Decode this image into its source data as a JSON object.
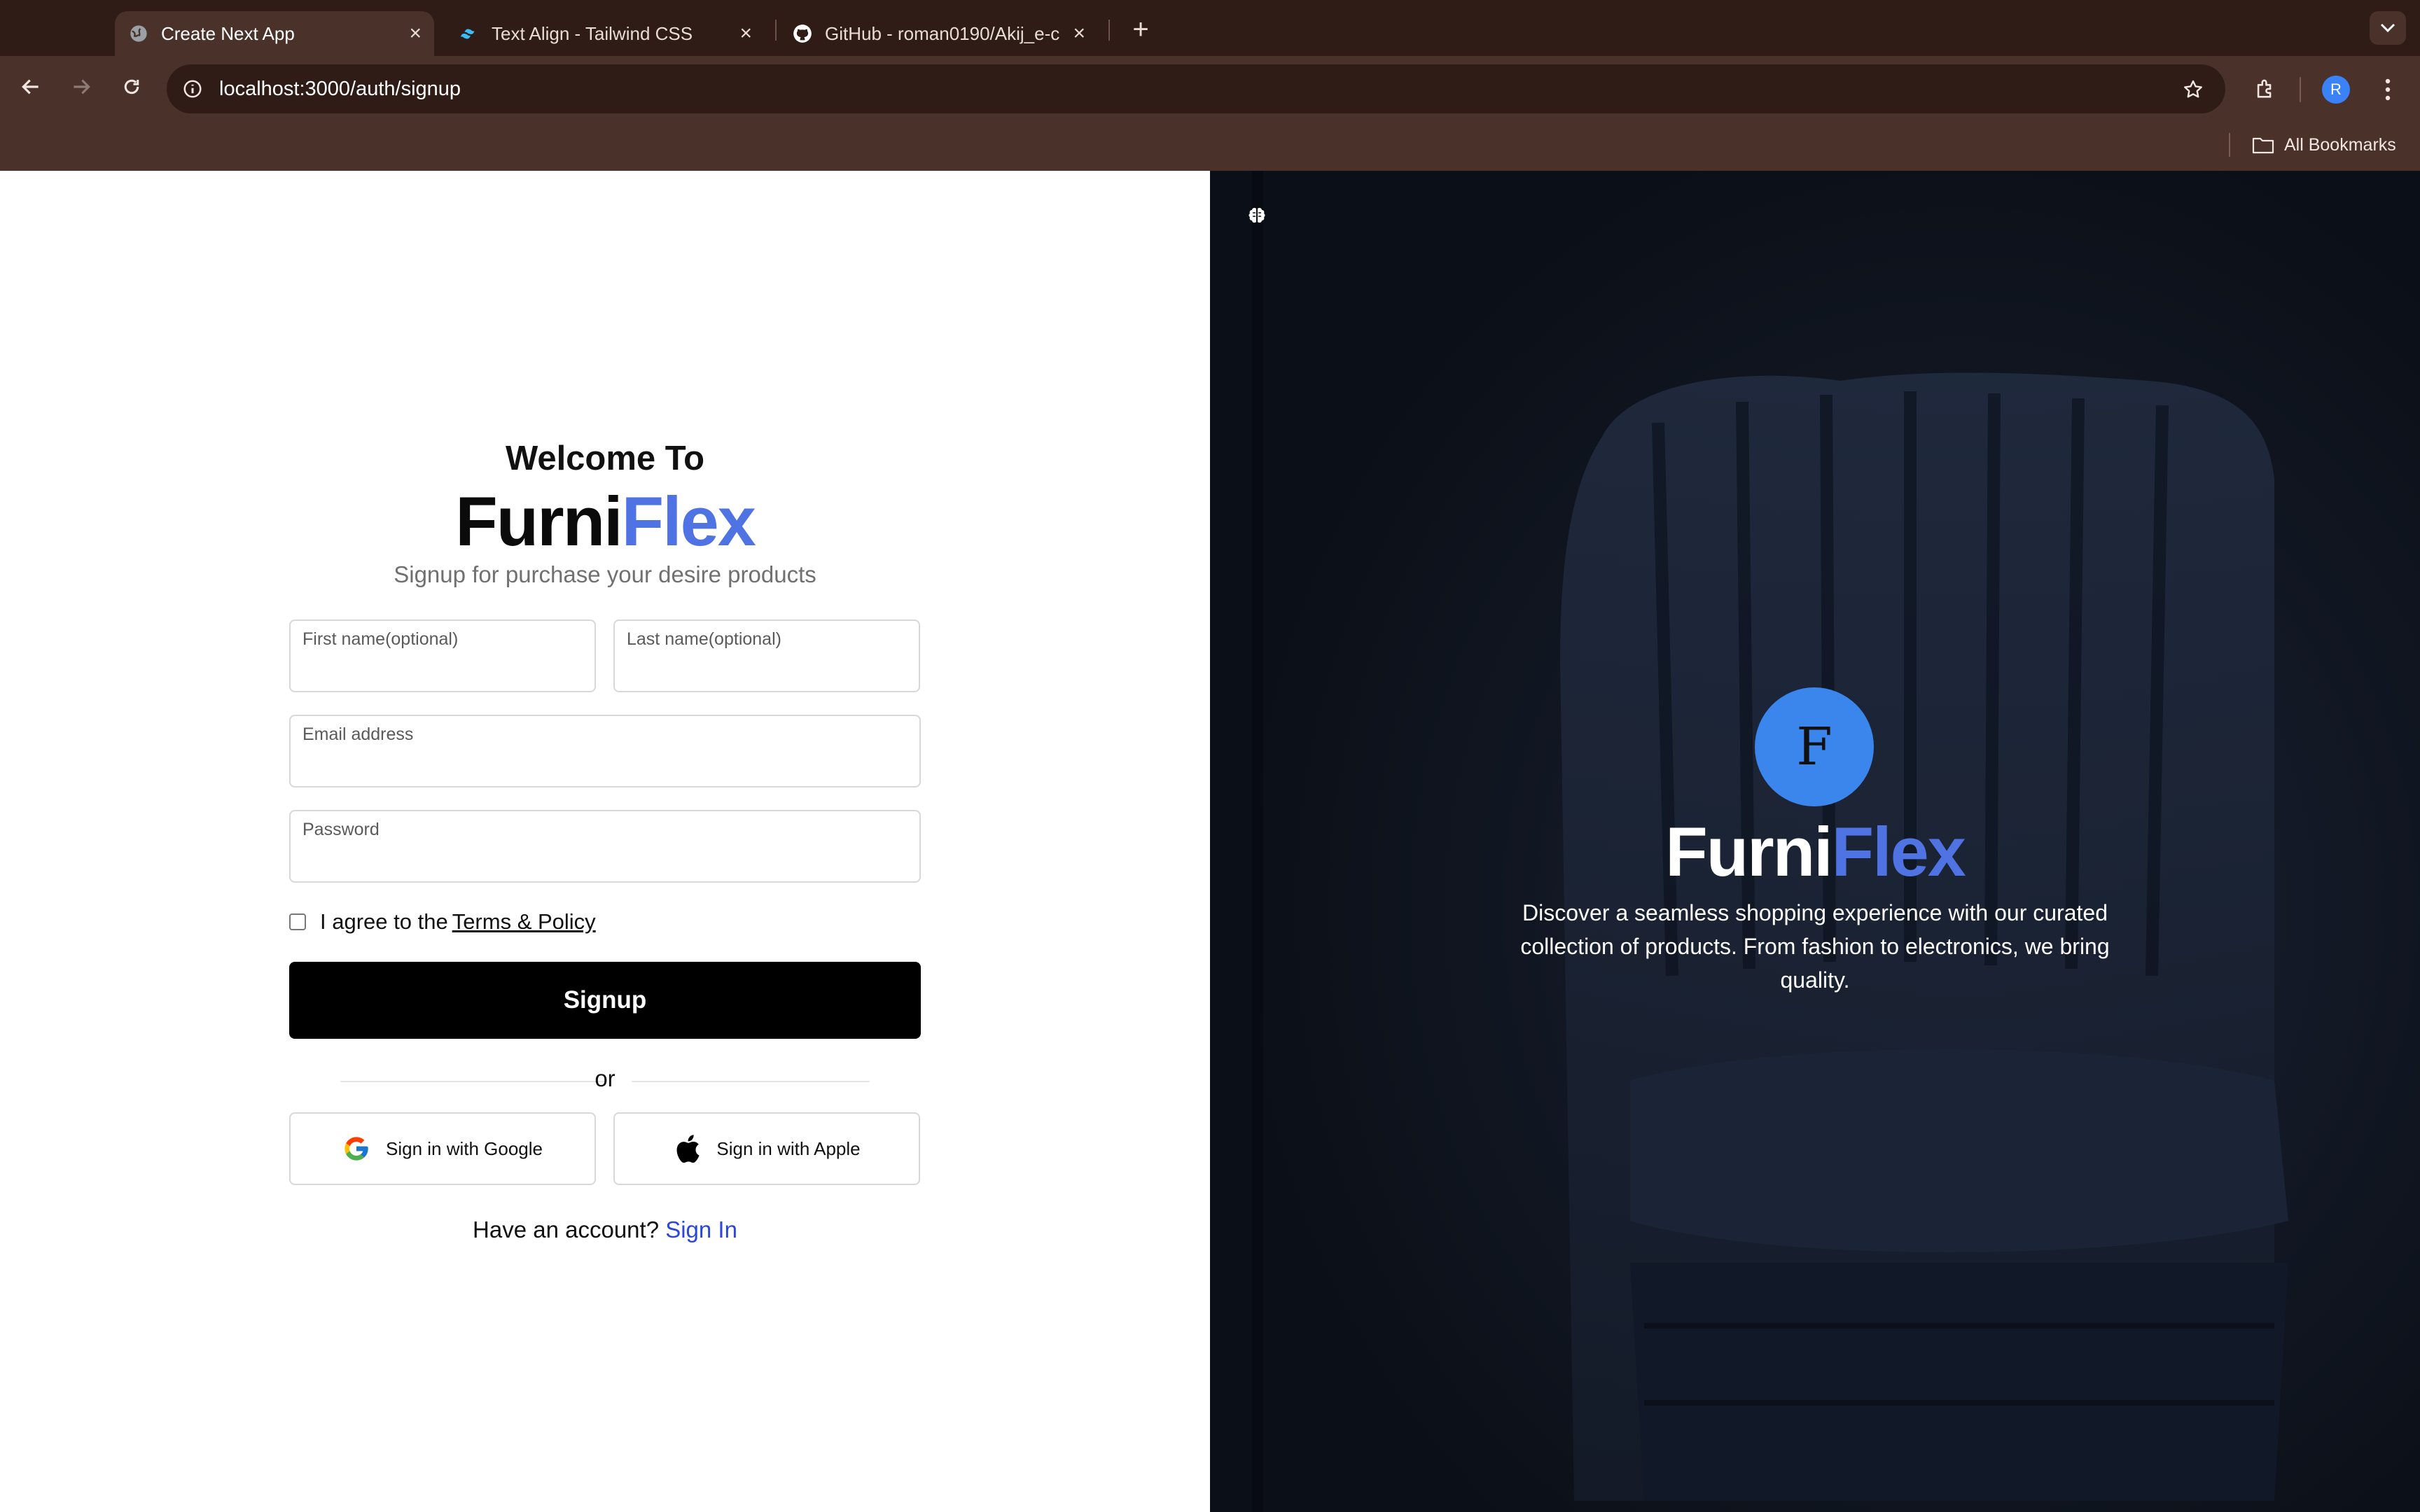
{
  "browser": {
    "tabs": [
      {
        "title": "Create Next App",
        "active": true,
        "icon": "globe-icon"
      },
      {
        "title": "Text Align - Tailwind CSS",
        "active": false,
        "icon": "tailwind-icon"
      },
      {
        "title": "GitHub - roman0190/Akij_e-c",
        "active": false,
        "icon": "github-icon"
      }
    ],
    "url": "localhost:3000/auth/signup",
    "avatar_letter": "R",
    "bookmarks_label": "All Bookmarks"
  },
  "signup": {
    "welcome": "Welcome To",
    "brand_part1": "Furni",
    "brand_part2": "Flex",
    "tagline": "Signup for purchase your desire products",
    "first_name_label": "First name(optional)",
    "last_name_label": "Last name(optional)",
    "email_label": "Email address",
    "password_label": "Password",
    "agree_text": "I agree to the",
    "terms_link": "Terms & Policy",
    "submit_label": "Signup",
    "or_text": "or",
    "google_label": "Sign in with Google",
    "apple_label": "Sign in with Apple",
    "have_account": "Have an account?",
    "signin_link": "Sign In"
  },
  "hero": {
    "logo_letter": "F",
    "brand_part1": "Furni",
    "brand_part2": "Flex",
    "description": "Discover a seamless shopping experience with our curated collection of products. From fashion to electronics, we bring quality."
  },
  "colors": {
    "chrome_dark": "#2f1c16",
    "chrome": "#4a3129",
    "brand_blue": "#4f73e3",
    "logo_blue": "#3a86ec",
    "link_blue": "#2c47d8"
  }
}
